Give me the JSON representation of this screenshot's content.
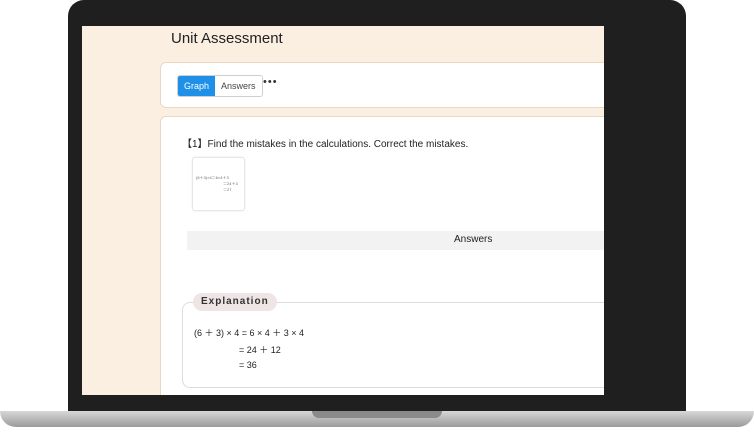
{
  "page_title": "Unit Assessment",
  "toolbar": {
    "tabs": [
      {
        "label": "Graph",
        "active": true
      },
      {
        "label": "Answers",
        "active": false
      }
    ],
    "more_icon": "more-horizontal-icon"
  },
  "question": {
    "text": "【1】Find the mistakes in the calculations.  Correct the mistakes.",
    "thumbnail_lines": [
      "(6＋3)×4＝6×4＋3",
      "＝24＋3",
      "＝27"
    ]
  },
  "answers": {
    "label": "Answers"
  },
  "explanation": {
    "label": "Explanation",
    "lines": [
      "(6 ＋ 3) × 4 = 6 × 4 ＋ 3 × 4",
      "= 24 ＋ 12",
      "= 36"
    ]
  },
  "colors": {
    "screen_bg": "#fbefe2",
    "active_tab": "#1e90e8"
  }
}
